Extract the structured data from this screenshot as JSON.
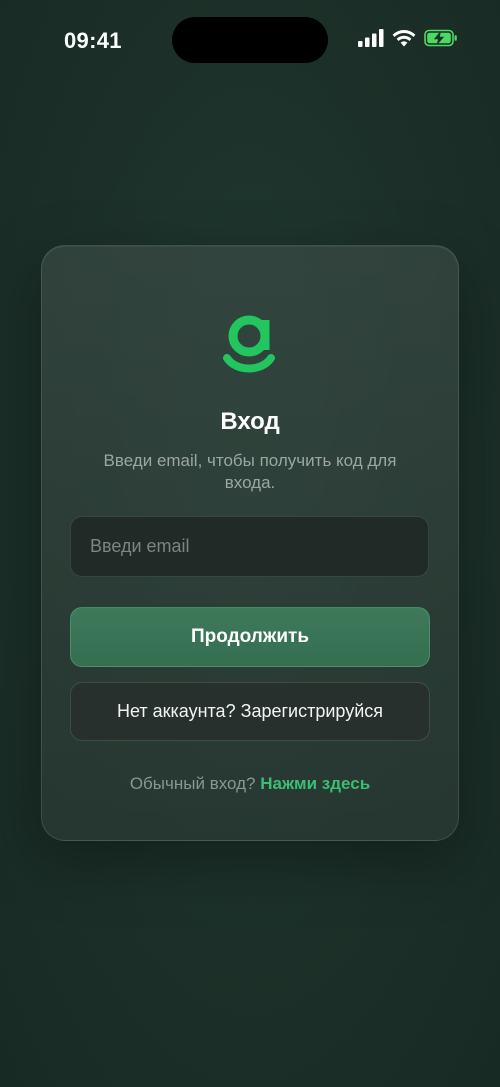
{
  "status_bar": {
    "time": "09:41",
    "icons": [
      "cellular-signal-icon",
      "wifi-icon",
      "battery-charging-icon"
    ]
  },
  "logo": {
    "icon": "brand-g-logo-icon",
    "color": "#22c55e"
  },
  "login": {
    "title": "Вход",
    "subtitle": "Введи email, чтобы получить код для входа.",
    "email_placeholder": "Введи email",
    "email_value": "",
    "continue_label": "Продолжить",
    "register_label": "Нет аккаунта? Зарегистрируйся",
    "alt_login_prefix": "Обычный вход?",
    "alt_login_link": "Нажми здесь"
  },
  "colors": {
    "accent": "#3dbd74",
    "primary_button": "#3a7556",
    "battery": "#4cd964"
  }
}
